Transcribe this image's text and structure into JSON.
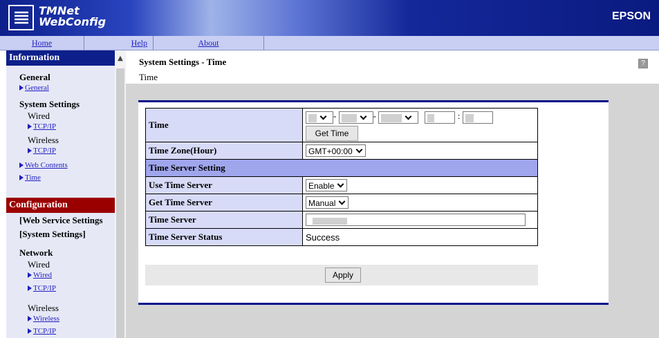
{
  "header": {
    "logo_line1": "TMNet",
    "logo_line2": "WebConfig",
    "brand": "EPSON",
    "colors": {
      "dark_blue": "#0d1f8a",
      "nav_bg": "#c9cff3",
      "config_red": "#9b0000",
      "accent_rule": "#000a8c"
    }
  },
  "nav": {
    "home": "Home",
    "help": "Help",
    "about": "About"
  },
  "sidebar": {
    "information_title": "Information",
    "general_heading": "General",
    "general_link": "General",
    "system_settings_heading": "System Settings",
    "wired_label": "Wired",
    "wired_tcpip": "TCP/IP",
    "wireless_label": "Wireless",
    "wireless_tcpip": "TCP/IP",
    "web_contents": "Web Contents",
    "time": "Time",
    "configuration_title": "Configuration",
    "web_service_settings": "[Web Service Settings",
    "system_settings_bracket": "[System Settings]",
    "network_heading": "Network",
    "net_wired_label": "Wired",
    "net_wired_link": "Wired",
    "net_wired_tcpip": "TCP/IP",
    "net_wireless_label": "Wireless",
    "net_wireless_link": "Wireless",
    "net_wireless_tcpip": "TCP/IP"
  },
  "main": {
    "page_title": "System Settings - Time",
    "subtitle": "Time",
    "help_icon": "?",
    "form": {
      "time_label": "Time",
      "get_time_button": "Get Time",
      "timezone_label": "Time Zone(Hour)",
      "timezone_value": "GMT+00:00",
      "section_time_server": "Time Server Setting",
      "use_time_server_label": "Use Time Server",
      "use_time_server_value": "Enable",
      "get_time_server_label": "Get Time Server",
      "get_time_server_value": "Manual",
      "time_server_label": "Time Server",
      "time_server_status_label": "Time Server Status",
      "time_server_status_value": "Success",
      "apply_button": "Apply"
    }
  }
}
